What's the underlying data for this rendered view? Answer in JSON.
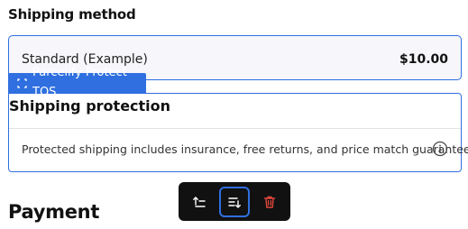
{
  "shipping_method": {
    "heading": "Shipping method",
    "option_name": "Standard (Example)",
    "option_price": "$10.00"
  },
  "badge": {
    "label": "Parcelify Protect TOS",
    "icon": "select-frame-icon"
  },
  "shipping_protection": {
    "title": "Shipping protection",
    "description": "Protected shipping includes insurance, free returns, and price match guarantee",
    "info_icon": "info-icon"
  },
  "payment": {
    "heading": "Payment"
  },
  "toolbar": {
    "buttons": [
      {
        "icon": "move-up-icon",
        "active": false
      },
      {
        "icon": "move-down-icon",
        "active": true
      },
      {
        "icon": "trash-icon",
        "active": false
      }
    ]
  },
  "colors": {
    "accent": "#2f6fe0",
    "danger": "#e0473b",
    "toolbar_bg": "#111111"
  }
}
